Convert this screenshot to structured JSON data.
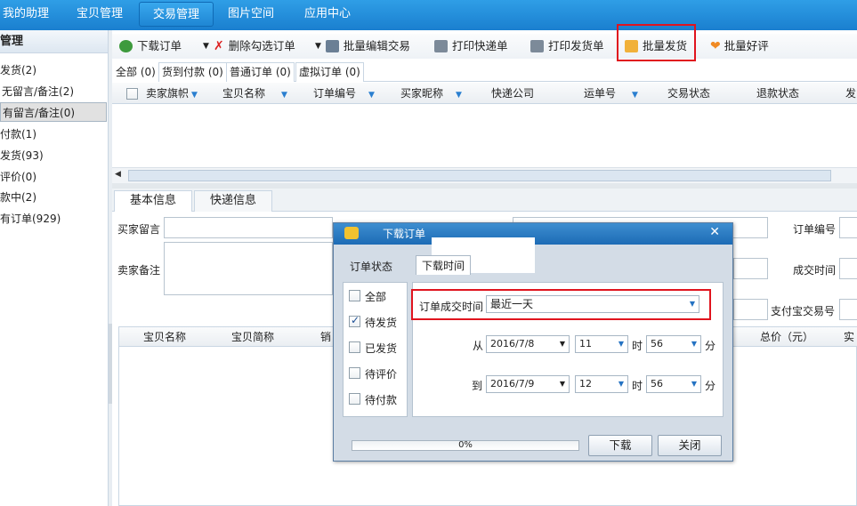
{
  "topnav": {
    "tabs": [
      {
        "label": "我的助理"
      },
      {
        "label": "宝贝管理"
      },
      {
        "label": "交易管理",
        "active": true
      },
      {
        "label": "图片空间"
      },
      {
        "label": "应用中心"
      }
    ]
  },
  "sidebar": {
    "title": "管理",
    "items": [
      {
        "label": "发货(2)"
      },
      {
        "label": "无留言/备注(2)"
      },
      {
        "label": "有留言/备注(0)",
        "selected": true
      },
      {
        "label": "付款(1)"
      },
      {
        "label": "发货(93)"
      },
      {
        "label": "评价(0)"
      },
      {
        "label": "款中(2)"
      },
      {
        "label": "有订单(929)"
      }
    ]
  },
  "toolbar": {
    "download": "下载订单",
    "delete": "删除勾选订单",
    "batch_edit": "批量编辑交易",
    "print_express": "打印快递单",
    "print_invoice": "打印发货单",
    "batch_ship": "批量发货",
    "batch_review": "批量好评"
  },
  "subtabs": [
    {
      "label": "全部 (0)"
    },
    {
      "label": "货到付款 (0)"
    },
    {
      "label": "普通订单 (0)"
    },
    {
      "label": "虚拟订单 (0)"
    }
  ],
  "grid": {
    "columns": [
      "卖家旗帜",
      "宝贝名称",
      "订单编号",
      "买家昵称",
      "快递公司",
      "运单号",
      "交易状态",
      "退款状态",
      "发"
    ]
  },
  "bottom_tabs": [
    "基本信息",
    "快递信息"
  ],
  "form": {
    "buyer_message": "买家留言",
    "seller_note": "卖家备注",
    "order_no": "订单编号",
    "deal_time": "成交时间",
    "alipay_no": "支付宝交易号"
  },
  "items_grid": {
    "columns": [
      "宝贝名称",
      "宝贝简称",
      "销",
      "总价（元）",
      "实"
    ]
  },
  "dialog": {
    "title": "下载订单",
    "tab_status": "订单状态",
    "tab_time": "下载时间",
    "statuses": [
      {
        "label": "全部",
        "checked": false
      },
      {
        "label": "待发货",
        "checked": true
      },
      {
        "label": "已发货",
        "checked": false
      },
      {
        "label": "待评价",
        "checked": false
      },
      {
        "label": "待付款",
        "checked": false
      }
    ],
    "deal_time_label": "订单成交时间",
    "deal_time_value": "最近一天",
    "from_label": "从",
    "from_date": "2016/7/8",
    "from_hour": "11",
    "from_min": "56",
    "to_label": "到",
    "to_date": "2016/7/9",
    "to_hour": "12",
    "to_min": "56",
    "hour_unit": "时",
    "min_unit": "分",
    "progress": "0%",
    "download_btn": "下载",
    "close_btn": "关闭"
  },
  "colors": {
    "accent": "#1a7fcf",
    "highlight": "#e0141e"
  }
}
